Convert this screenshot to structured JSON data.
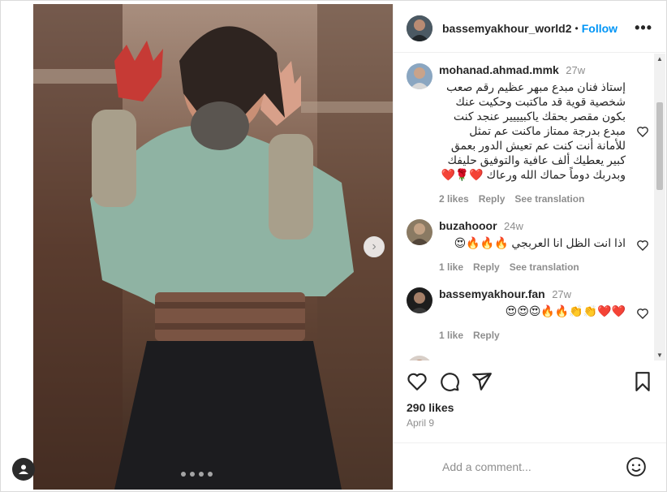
{
  "post": {
    "username": "bassemyakhour_world2",
    "separator": "•",
    "follow_label": "Follow",
    "more_label": "•••",
    "likes": "290 likes",
    "date": "April 9",
    "add_comment_placeholder": "Add a comment...",
    "media_slide_count": 4
  },
  "comments": [
    {
      "username": "mohanad.ahmad.mmk",
      "time": "27w",
      "text": "إستاذ فنان مبدع مبهر عظيم رقم صعب شخصية قوية قد ماكتبت وحكيت عنك بكون مقصر بحقك ياكبيييير عنجد كنت مبدع بدرجة ممتاز ماكنت عم تمثل للأمانة أنت كنت عم تعيش الدور بعمق كبير يعطيك ألف عافية والتوفيق حليفك وبدربك دوماً حماك الله ورعاك ❤️🌹❤️",
      "likes": "2 likes",
      "reply": "Reply",
      "translation": "See translation"
    },
    {
      "username": "buzahooor",
      "time": "24w",
      "text": "اذا انت الظل انا العربجي 🔥🔥🔥😍",
      "likes": "1 like",
      "reply": "Reply",
      "translation": "See translation"
    },
    {
      "username": "bassemyakhour.fan",
      "time": "27w",
      "text": "❤️❤️👏👏🔥🔥😍😍😍",
      "likes": "1 like",
      "reply": "Reply",
      "translation": ""
    }
  ],
  "icons": {
    "like": "heart-icon",
    "comment": "comment-icon",
    "share": "share-icon",
    "save": "bookmark-icon",
    "emoji": "emoji-icon",
    "next": "chevron-right-icon"
  },
  "colors": {
    "accent": "#0095f6",
    "muted": "#8e8e8e",
    "text": "#262626",
    "heart_red": "#ed4956"
  }
}
